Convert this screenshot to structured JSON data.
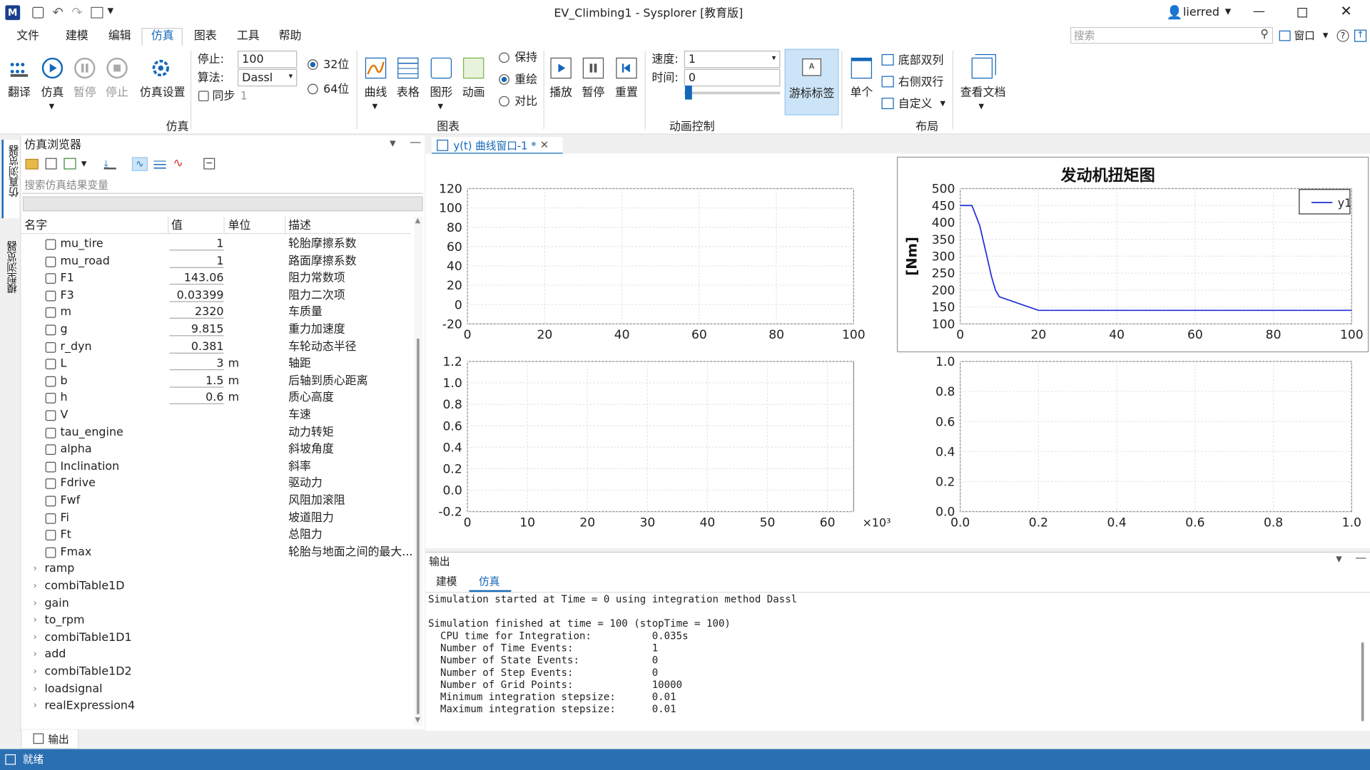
{
  "window": {
    "title": "EV_Climbing1 - Sysplorer [教育版]",
    "user": "lierred",
    "search_placeholder": "搜索",
    "window_menu": "窗口"
  },
  "menu": [
    "文件",
    "建模",
    "编辑",
    "仿真",
    "图表",
    "工具",
    "帮助"
  ],
  "ribbon": {
    "sim_buttons": [
      "翻译",
      "仿真",
      "暂停",
      "停止",
      "仿真设置"
    ],
    "stop_label": "停止:",
    "stop_value": "100",
    "algo_label": "算法:",
    "algo_value": "Dassl",
    "sync_label": "同步",
    "sync_value": "1",
    "bit32": "32位",
    "bit64": "64位",
    "group_sim": "仿真",
    "chart_buttons": [
      "曲线",
      "表格",
      "图形",
      "动画"
    ],
    "keep": "保持",
    "redraw": "重绘",
    "compare": "对比",
    "group_chart": "图表",
    "anim_buttons": [
      "播放",
      "暂停",
      "重置"
    ],
    "speed_label": "速度:",
    "speed_value": "1",
    "time_label": "时间:",
    "time_value": "0",
    "cursor_label": "游标标签",
    "group_anim": "动画控制",
    "single": "单个",
    "layout_bottom": "底部双列",
    "layout_right": "右侧双行",
    "layout_custom": "自定义",
    "group_layout": "布局",
    "docs": "查看文档"
  },
  "browser": {
    "title": "仿真浏览器",
    "search_placeholder": "搜索仿真结果变量",
    "columns": [
      "名字",
      "值",
      "单位",
      "描述"
    ],
    "side_tabs": [
      "仿真浏览器",
      "模型浏览器"
    ],
    "vars": [
      {
        "name": "mu_tire",
        "value": "1",
        "unit": "",
        "desc": "轮胎摩擦系数"
      },
      {
        "name": "mu_road",
        "value": "1",
        "unit": "",
        "desc": "路面摩擦系数"
      },
      {
        "name": "F1",
        "value": "143.06",
        "unit": "",
        "desc": "阻力常数项"
      },
      {
        "name": "F3",
        "value": "0.03399",
        "unit": "",
        "desc": "阻力二次项"
      },
      {
        "name": "m",
        "value": "2320",
        "unit": "",
        "desc": "车质量"
      },
      {
        "name": "g",
        "value": "9.815",
        "unit": "",
        "desc": "重力加速度"
      },
      {
        "name": "r_dyn",
        "value": "0.381",
        "unit": "",
        "desc": "车轮动态半径"
      },
      {
        "name": "L",
        "value": "3",
        "unit": "m",
        "desc": "轴距"
      },
      {
        "name": "b",
        "value": "1.5",
        "unit": "m",
        "desc": "后轴到质心距离"
      },
      {
        "name": "h",
        "value": "0.6",
        "unit": "m",
        "desc": "质心高度"
      },
      {
        "name": "V",
        "value": "",
        "unit": "",
        "desc": "车速"
      },
      {
        "name": "tau_engine",
        "value": "",
        "unit": "",
        "desc": "动力转矩"
      },
      {
        "name": "alpha",
        "value": "",
        "unit": "",
        "desc": "斜坡角度"
      },
      {
        "name": "Inclination",
        "value": "",
        "unit": "",
        "desc": "斜率"
      },
      {
        "name": "Fdrive",
        "value": "",
        "unit": "",
        "desc": "驱动力"
      },
      {
        "name": "Fwf",
        "value": "",
        "unit": "",
        "desc": "风阻加滚阻"
      },
      {
        "name": "Fi",
        "value": "",
        "unit": "",
        "desc": "坡道阻力"
      },
      {
        "name": "Ft",
        "value": "",
        "unit": "",
        "desc": "总阻力"
      },
      {
        "name": "Fmax",
        "value": "",
        "unit": "",
        "desc": "轮胎与地面之间的最大..."
      }
    ],
    "components": [
      "ramp",
      "combiTable1D",
      "gain",
      "to_rpm",
      "combiTable1D1",
      "add",
      "combiTable1D2",
      "loadsignal",
      "realExpression4"
    ],
    "bottom_tab": "输出"
  },
  "plot_tab": "y(t) 曲线窗口-1 *",
  "chart_data": [
    {
      "type": "line",
      "title": "",
      "x_ticks": [
        "0",
        "20",
        "40",
        "60",
        "80",
        "100"
      ],
      "y_ticks": [
        "120",
        "100",
        "80",
        "60",
        "40",
        "20",
        "0",
        "-20"
      ],
      "series": []
    },
    {
      "type": "line",
      "title": "发动机扭矩图",
      "ylabel": "[Nm]",
      "x_ticks": [
        "0",
        "20",
        "40",
        "60",
        "80",
        "100"
      ],
      "y_ticks": [
        "500",
        "450",
        "400",
        "350",
        "300",
        "250",
        "200",
        "150",
        "100"
      ],
      "xlim": [
        0,
        100
      ],
      "ylim": [
        100,
        500
      ],
      "legend": "top-right",
      "series": [
        {
          "name": "y1",
          "color": "#1f2fd6",
          "x": [
            0,
            3,
            4,
            5,
            6,
            7,
            8,
            9,
            10,
            20,
            40,
            60,
            80,
            100
          ],
          "y": [
            450,
            450,
            420,
            390,
            340,
            290,
            240,
            200,
            180,
            140,
            140,
            140,
            140,
            140
          ]
        }
      ]
    },
    {
      "type": "line",
      "title": "",
      "x_ticks": [
        "0",
        "10",
        "20",
        "30",
        "40",
        "50",
        "60"
      ],
      "x_multiplier": "×10³",
      "y_ticks": [
        "1.2",
        "1.0",
        "0.8",
        "0.6",
        "0.4",
        "0.2",
        "0.0",
        "-0.2"
      ],
      "series": []
    },
    {
      "type": "line",
      "title": "",
      "x_ticks": [
        "0.0",
        "0.2",
        "0.4",
        "0.6",
        "0.8",
        "1.0"
      ],
      "y_ticks": [
        "1.0",
        "0.8",
        "0.6",
        "0.4",
        "0.2",
        "0.0"
      ],
      "series": []
    }
  ],
  "output": {
    "title": "输出",
    "tabs": [
      "建模",
      "仿真"
    ],
    "lines": [
      "Simulation started at Time = 0 using integration method Dassl",
      "",
      "Simulation finished at time = 100 (stopTime = 100)",
      "  CPU time for Integration:          0.035s",
      "  Number of Time Events:             1",
      "  Number of State Events:            0",
      "  Number of Step Events:             0",
      "  Number of Grid Points:             10000",
      "  Minimum integration stepsize:      0.01",
      "  Maximum integration stepsize:      0.01"
    ]
  },
  "status": "就绪"
}
